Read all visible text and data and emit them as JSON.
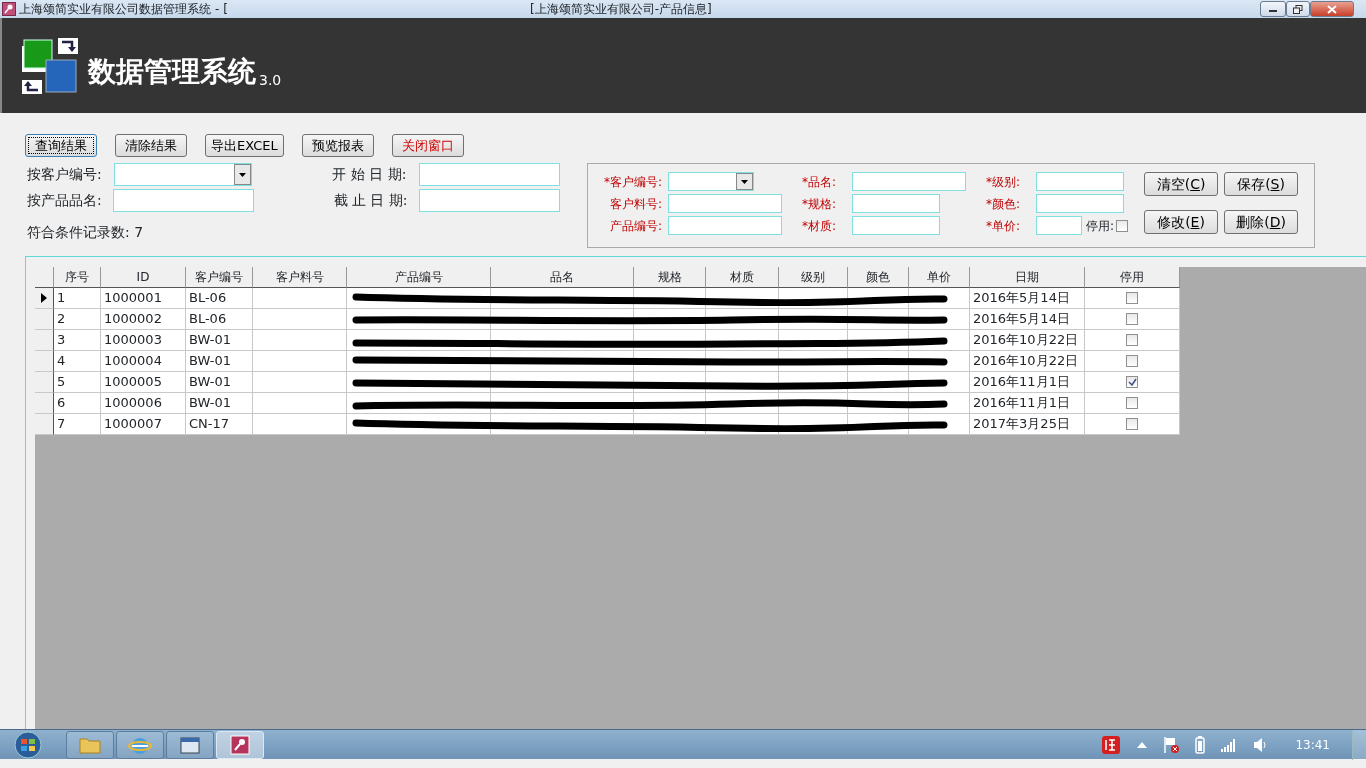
{
  "window": {
    "title": "上海颂简实业有限公司数据管理系统 - [",
    "document_title": "[上海颂简实业有限公司-产品信息]"
  },
  "header": {
    "app_name": "数据管理系统",
    "version": "3.0"
  },
  "toolbar": [
    {
      "label": "查询结果",
      "kind": "normal",
      "focused": true
    },
    {
      "label": "清除结果",
      "kind": "normal",
      "focused": false
    },
    {
      "label": "导出EXCEL",
      "kind": "normal",
      "focused": false
    },
    {
      "label": "预览报表",
      "kind": "normal",
      "focused": false
    },
    {
      "label": "关闭窗口",
      "kind": "danger",
      "focused": false
    }
  ],
  "search": {
    "fields": [
      {
        "label": "按客户编号:",
        "kind": "combo"
      },
      {
        "label": "开 始 日 期:",
        "kind": "text"
      },
      {
        "label": "按产品品名:",
        "kind": "text"
      },
      {
        "label": "截 止 日 期:",
        "kind": "text"
      }
    ],
    "record_count": "符合条件记录数: 7"
  },
  "editor": {
    "columns": [
      [
        {
          "label": "*客户编号:",
          "kind": "combo"
        },
        {
          "label": "客户料号:",
          "kind": "text"
        },
        {
          "label": "产品编号:",
          "kind": "text"
        }
      ],
      [
        {
          "label": "*品名:",
          "kind": "wide"
        },
        {
          "label": "*规格:",
          "kind": "text"
        },
        {
          "label": "*材质:",
          "kind": "text"
        }
      ],
      [
        {
          "label": "*级别:",
          "kind": "text"
        },
        {
          "label": "*颜色:",
          "kind": "text"
        },
        {
          "label": "*单价:",
          "kind": "short"
        }
      ]
    ],
    "disabled_checkbox": {
      "label": "停用:",
      "checked": false
    },
    "buttons": [
      {
        "before": "清空(",
        "key": "C",
        "after": ")"
      },
      {
        "before": "保存(",
        "key": "S",
        "after": ")"
      },
      {
        "before": "修改(",
        "key": "E",
        "after": ")"
      },
      {
        "before": "删除(",
        "key": "D",
        "after": ")"
      }
    ]
  },
  "table": {
    "columns": [
      "序号",
      "ID",
      "客户编号",
      "客户料号",
      "产品编号",
      "品名",
      "规格",
      "材质",
      "级别",
      "颜色",
      "单价",
      "日期",
      "停用"
    ],
    "rows": [
      {
        "no": "1",
        "id": "1000001",
        "customer": "BL-06",
        "date": "2016年5月14日",
        "disabled": false,
        "current": true,
        "redacted": true
      },
      {
        "no": "2",
        "id": "1000002",
        "customer": "BL-06",
        "date": "2016年5月14日",
        "disabled": false,
        "current": false,
        "redacted": true
      },
      {
        "no": "3",
        "id": "1000003",
        "customer": "BW-01",
        "date": "2016年10月22日",
        "disabled": false,
        "current": false,
        "redacted": true
      },
      {
        "no": "4",
        "id": "1000004",
        "customer": "BW-01",
        "date": "2016年10月22日",
        "disabled": false,
        "current": false,
        "redacted": true
      },
      {
        "no": "5",
        "id": "1000005",
        "customer": "BW-01",
        "date": "2016年11月1日",
        "disabled": true,
        "current": false,
        "redacted": true
      },
      {
        "no": "6",
        "id": "1000006",
        "customer": "BW-01",
        "date": "2016年11月1日",
        "disabled": false,
        "current": false,
        "redacted": true
      },
      {
        "no": "7",
        "id": "1000007",
        "customer": "CN-17",
        "date": "2017年3月25日",
        "disabled": false,
        "current": false,
        "redacted": true
      }
    ]
  },
  "taskbar": {
    "apps": [
      {
        "kind": "folder",
        "active": false
      },
      {
        "kind": "browser",
        "active": false
      },
      {
        "kind": "window",
        "active": false
      },
      {
        "kind": "access",
        "active": true
      }
    ],
    "time": "13:41"
  }
}
